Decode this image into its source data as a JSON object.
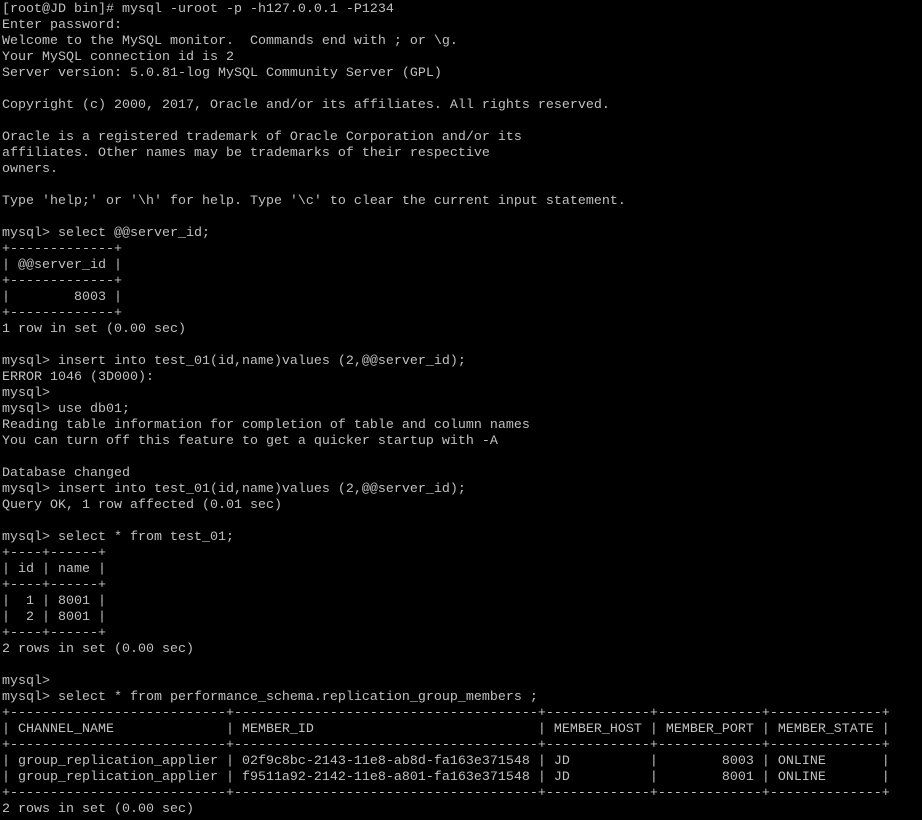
{
  "terminal": {
    "colors": {
      "background": "#000000",
      "foreground": "#c0c0c0"
    },
    "lines": [
      "[root@JD bin]# mysql -uroot -p -h127.0.0.1 -P1234",
      "Enter password:",
      "Welcome to the MySQL monitor.  Commands end with ; or \\g.",
      "Your MySQL connection id is 2",
      "Server version: 5.0.81-log MySQL Community Server (GPL)",
      "",
      "Copyright (c) 2000, 2017, Oracle and/or its affiliates. All rights reserved.",
      "",
      "Oracle is a registered trademark of Oracle Corporation and/or its",
      "affiliates. Other names may be trademarks of their respective",
      "owners.",
      "",
      "Type 'help;' or '\\h' for help. Type '\\c' to clear the current input statement.",
      "",
      "mysql> select @@server_id;",
      "+-------------+",
      "| @@server_id |",
      "+-------------+",
      "|        8003 |",
      "+-------------+",
      "1 row in set (0.00 sec)",
      "",
      "mysql> insert into test_01(id,name)values (2,@@server_id);",
      "ERROR 1046 (3D000):",
      "mysql>",
      "mysql> use db01;",
      "Reading table information for completion of table and column names",
      "You can turn off this feature to get a quicker startup with -A",
      "",
      "Database changed",
      "mysql> insert into test_01(id,name)values (2,@@server_id);",
      "Query OK, 1 row affected (0.01 sec)",
      "",
      "mysql> select * from test_01;",
      "+----+------+",
      "| id | name |",
      "+----+------+",
      "|  1 | 8001 |",
      "|  2 | 8001 |",
      "+----+------+",
      "2 rows in set (0.00 sec)",
      "",
      "mysql>",
      "mysql> select * from performance_schema.replication_group_members ;",
      "+---------------------------+--------------------------------------+-------------+-------------+--------------+",
      "| CHANNEL_NAME              | MEMBER_ID                            | MEMBER_HOST | MEMBER_PORT | MEMBER_STATE |",
      "+---------------------------+--------------------------------------+-------------+-------------+--------------+",
      "| group_replication_applier | 02f9c8bc-2143-11e8-ab8d-fa163e371548 | JD          |        8003 | ONLINE       |",
      "| group_replication_applier | f9511a92-2142-11e8-a801-fa163e371548 | JD          |        8001 | ONLINE       |",
      "+---------------------------+--------------------------------------+-------------+-------------+--------------+",
      "2 rows in set (0.00 sec)"
    ]
  }
}
